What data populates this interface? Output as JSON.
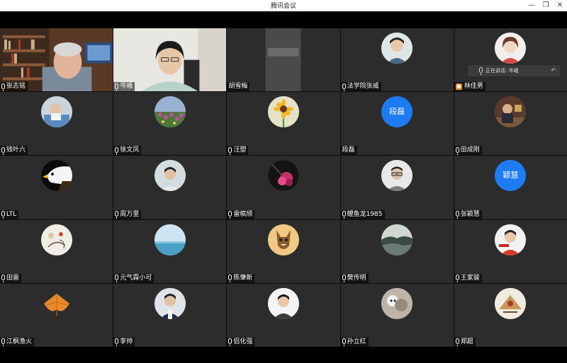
{
  "window": {
    "title": "腾讯会议",
    "buttons": {
      "minimize": "—",
      "restore": "❐",
      "close": "✕"
    }
  },
  "speaking_indicator": {
    "label": "正在讲话: 岑峨"
  },
  "participants": [
    {
      "name": "张志铭",
      "type": "video"
    },
    {
      "name": "岑峨",
      "type": "video"
    },
    {
      "name": "胡雪梅",
      "type": "video",
      "muted": false
    },
    {
      "name": "法学院张威",
      "type": "avatar"
    },
    {
      "name": "林佳男",
      "type": "avatar",
      "badge": "cam"
    },
    {
      "name": "钱叶六",
      "type": "avatar"
    },
    {
      "name": "徐文凤",
      "type": "avatar"
    },
    {
      "name": "汪塑",
      "type": "avatar"
    },
    {
      "name": "段磊",
      "type": "text",
      "avatar_text": "段磊",
      "no_mic": true
    },
    {
      "name": "田成刚",
      "type": "avatar"
    },
    {
      "name": "LTL",
      "type": "avatar"
    },
    {
      "name": "周万里",
      "type": "avatar"
    },
    {
      "name": "雷槟颀",
      "type": "avatar"
    },
    {
      "name": "鲤鱼龙1985",
      "type": "avatar"
    },
    {
      "name": "张颖慧",
      "type": "text",
      "avatar_text": "颖慧"
    },
    {
      "name": "田雷",
      "type": "avatar"
    },
    {
      "name": "元气霖小可",
      "type": "avatar"
    },
    {
      "name": "陈肇新",
      "type": "avatar"
    },
    {
      "name": "樊传明",
      "type": "avatar"
    },
    {
      "name": "王家骏",
      "type": "avatar"
    },
    {
      "name": "江枫渔火",
      "type": "avatar"
    },
    {
      "name": "李帅",
      "type": "avatar"
    },
    {
      "name": "侣化强",
      "type": "avatar"
    },
    {
      "name": "孙立红",
      "type": "avatar"
    },
    {
      "name": "郑超",
      "type": "avatar"
    }
  ]
}
